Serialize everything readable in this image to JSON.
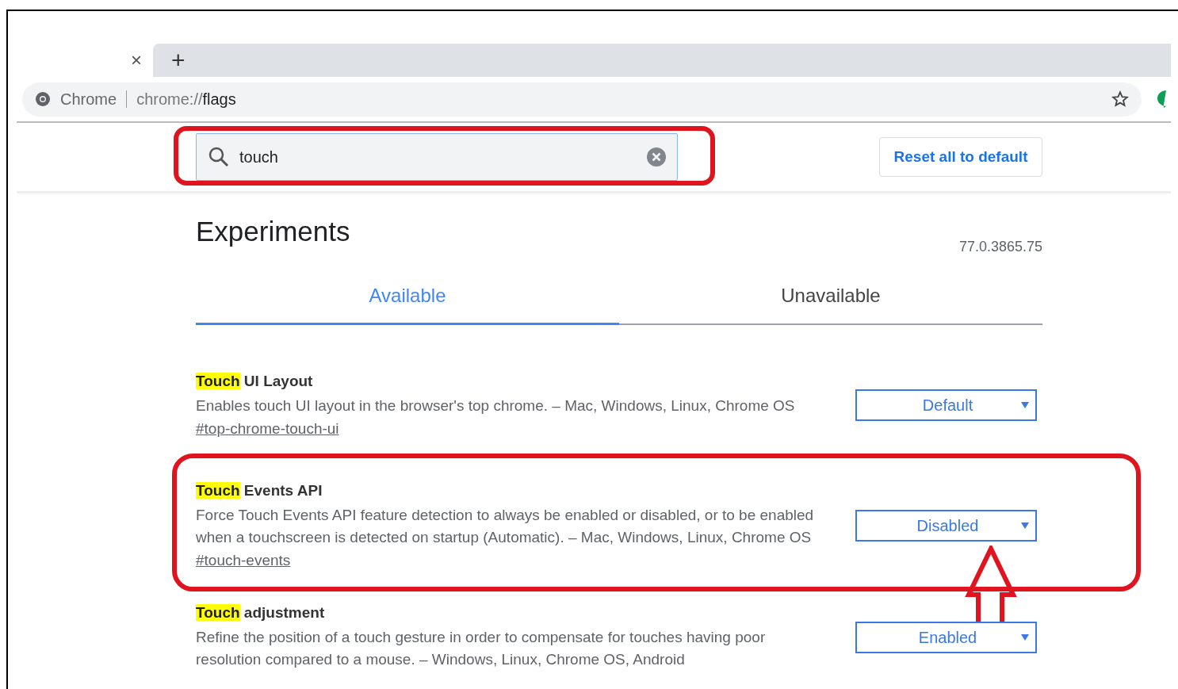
{
  "browser": {
    "tab_close": "×",
    "new_tab": "+",
    "site_label": "Chrome",
    "url_prefix": "chrome://",
    "url_path": "flags"
  },
  "search": {
    "value": "touch"
  },
  "reset_button": "Reset all to default",
  "title": "Experiments",
  "version": "77.0.3865.75",
  "tabs": [
    {
      "label": "Available",
      "selected": true
    },
    {
      "label": "Unavailable",
      "selected": false
    }
  ],
  "flags": [
    {
      "match": "Touch",
      "title": " UI Layout",
      "description": "Enables touch UI layout in the browser's top chrome. – Mac, Windows, Linux, Chrome OS",
      "link": "#top-chrome-touch-ui",
      "value": "Default",
      "annotated": false
    },
    {
      "match": "Touch",
      "title": " Events API",
      "description": "Force Touch Events API feature detection to always be enabled or disabled, or to be enabled when a touchscreen is detected on startup (Automatic). – Mac, Windows, Linux, Chrome OS",
      "link": "#touch-events",
      "value": "Disabled",
      "annotated": true
    },
    {
      "match": "Touch",
      "title": " adjustment",
      "description": "Refine the position of a touch gesture in order to compensate for touches having poor resolution compared to a mouse. – Windows, Linux, Chrome OS, Android",
      "value": "Enabled",
      "annotated": false
    }
  ]
}
